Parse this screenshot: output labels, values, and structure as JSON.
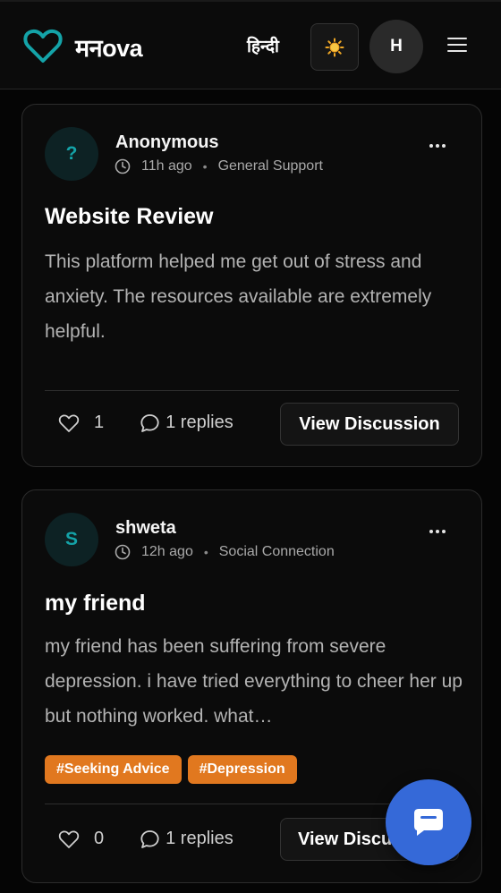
{
  "header": {
    "brand": "मनova",
    "language_toggle": "हिन्दी",
    "theme_icon": "sun-icon",
    "user_initial": "H",
    "menu_icon": "hamburger-icon",
    "brand_color": "#14a3a8"
  },
  "posts": [
    {
      "avatar": "?",
      "author": "Anonymous",
      "time": "11h ago",
      "category": "General Support",
      "title": "Website Review",
      "body": "This platform helped me get out of stress and anxiety. The resources available are extremely helpful.",
      "tags": [],
      "likes": "1",
      "replies": "1 replies",
      "view_label": "View Discussion"
    },
    {
      "avatar": "S",
      "author": "shweta",
      "time": "12h ago",
      "category": "Social Connection",
      "title": "my friend",
      "body": "my friend has been suffering from severe depression. i have tried everything to cheer her up but nothing worked. what…",
      "tags": [
        "#Seeking Advice",
        "#Depression"
      ],
      "likes": "0",
      "replies": "1 replies",
      "view_label": "View Discussion"
    }
  ],
  "chat": {
    "icon": "chat-bubble-icon",
    "color": "#3569d8"
  },
  "colors": {
    "tag": "#e1781f",
    "background": "#050505",
    "card": "#0b0b0b"
  }
}
